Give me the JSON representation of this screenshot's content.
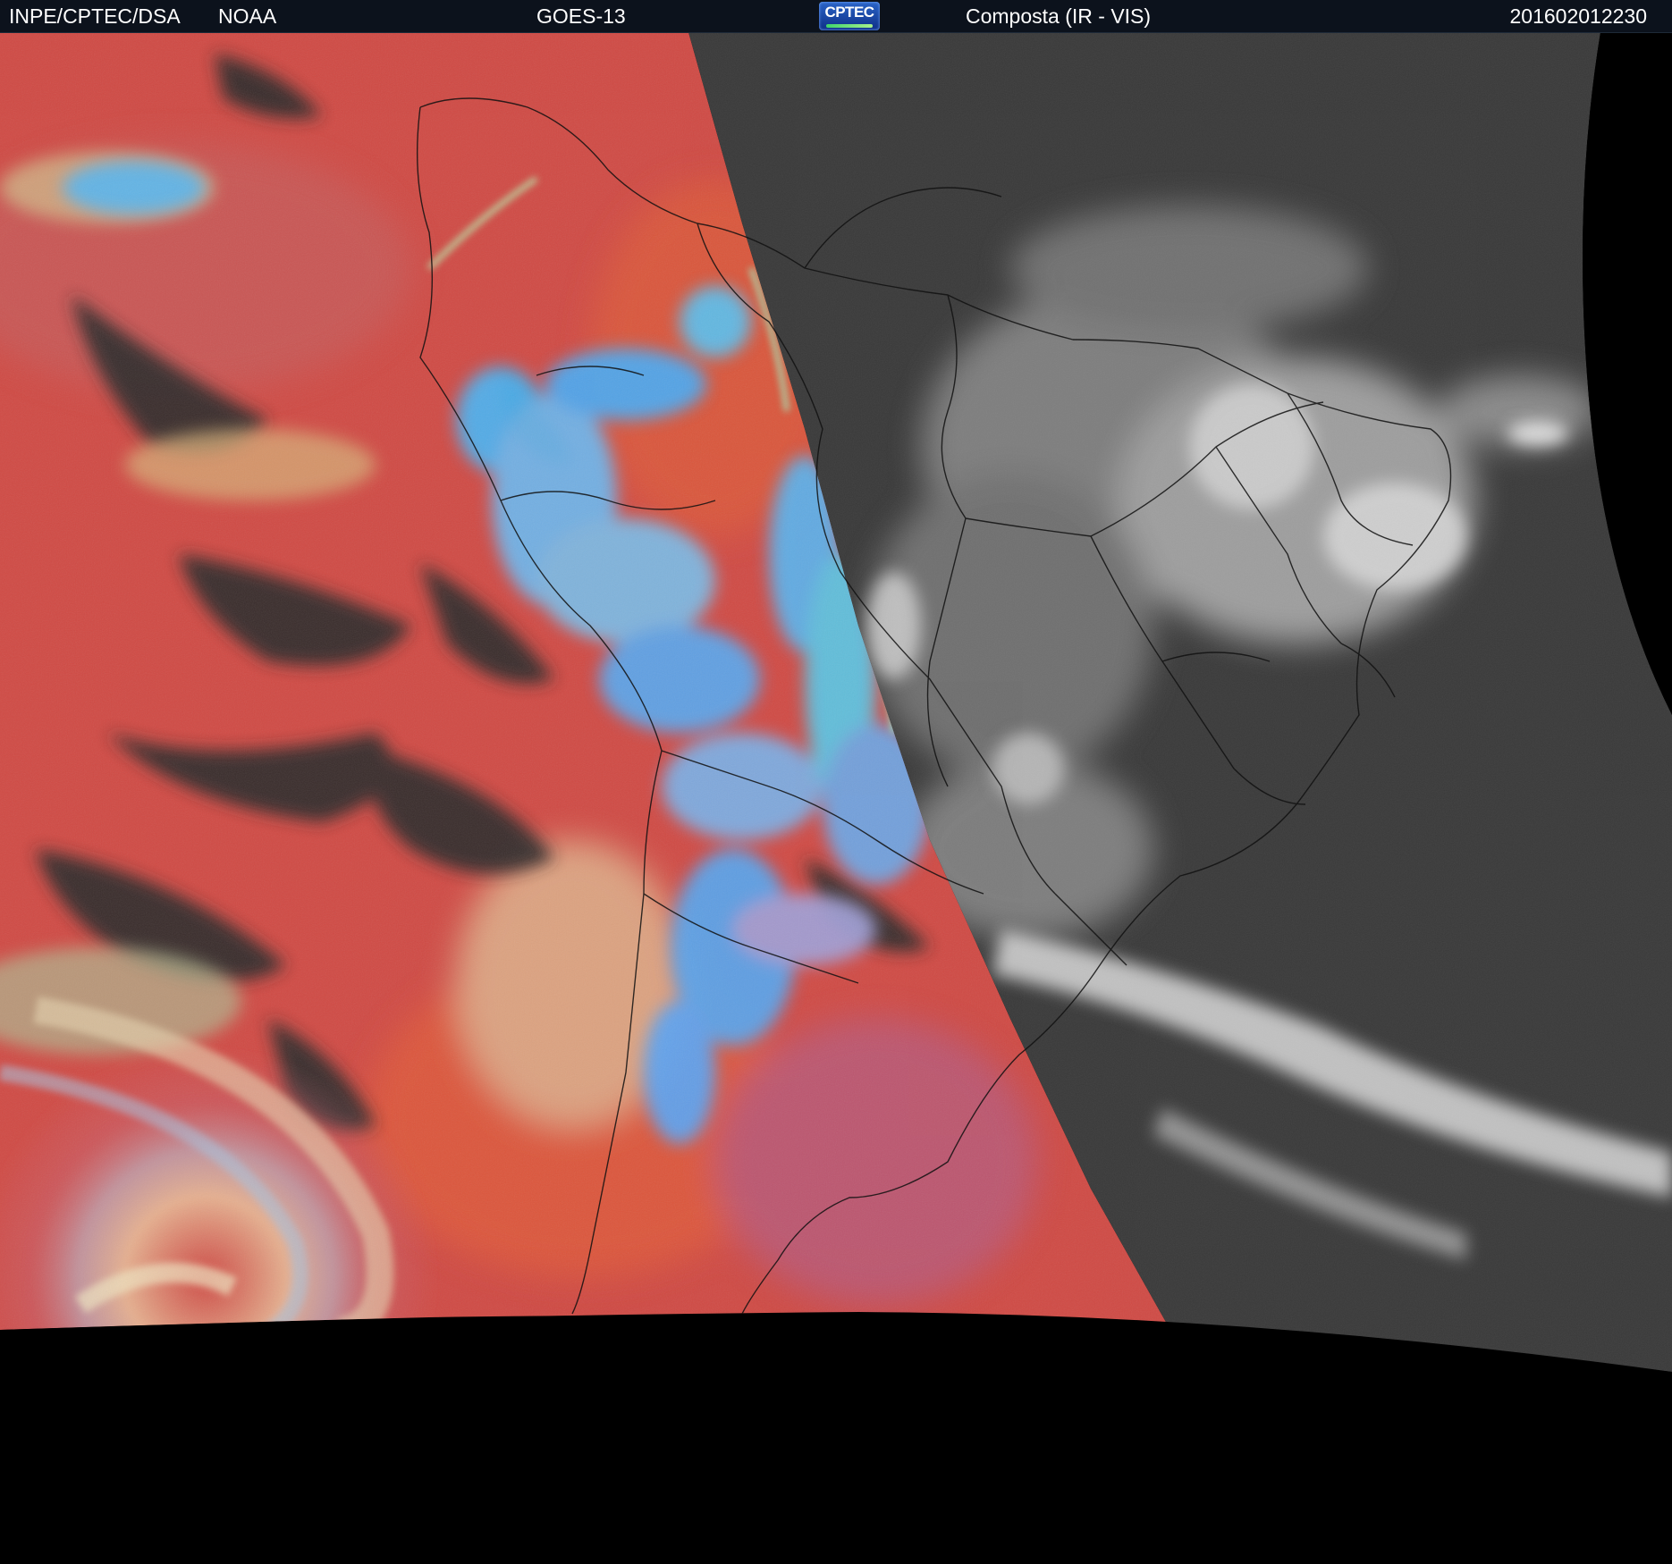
{
  "header": {
    "institution": "INPE/CPTEC/DSA",
    "agency": "NOAA",
    "satellite": "GOES-13",
    "logo_text": "CPTEC",
    "product": "Composta (IR - VIS)",
    "timestamp": "201602012230"
  },
  "colors": {
    "header_bg": "#0c121c",
    "ir_red": "#d04a44",
    "ir_cold_cloud": "#4aa8f0",
    "vis_gray": "#3c3c3c",
    "vis_cloud": "#d8d8d8",
    "space": "#000000",
    "borders": "#111111"
  }
}
